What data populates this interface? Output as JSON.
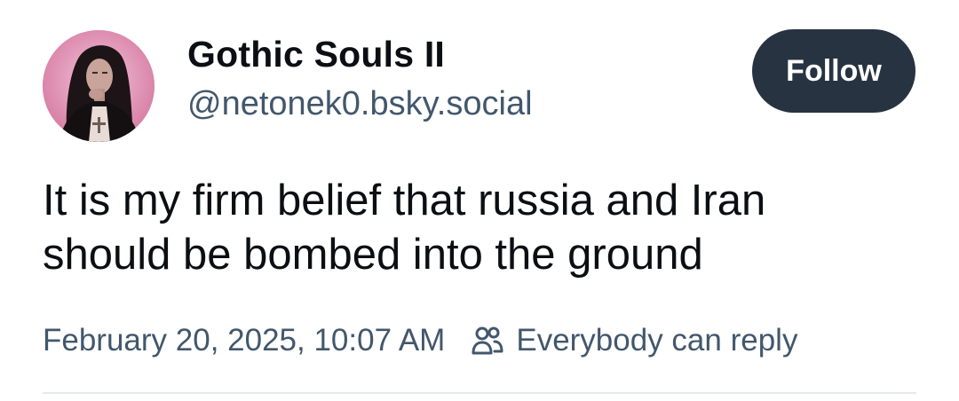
{
  "post": {
    "author": {
      "display_name": "Gothic Souls II",
      "handle": "@netonek0.bsky.social",
      "avatar_icon": "profile-photo"
    },
    "follow_label": "Follow",
    "text_lines": [
      "It is my firm belief that russia and Iran",
      "should be bombed into the ground"
    ],
    "timestamp": "February 20, 2025, 10:07 AM",
    "reply_setting": {
      "icon": "people-icon",
      "label": "Everybody can reply"
    }
  },
  "colors": {
    "button_bg": "#273341",
    "secondary_text": "#42576c",
    "primary_text": "#0b0f14"
  }
}
